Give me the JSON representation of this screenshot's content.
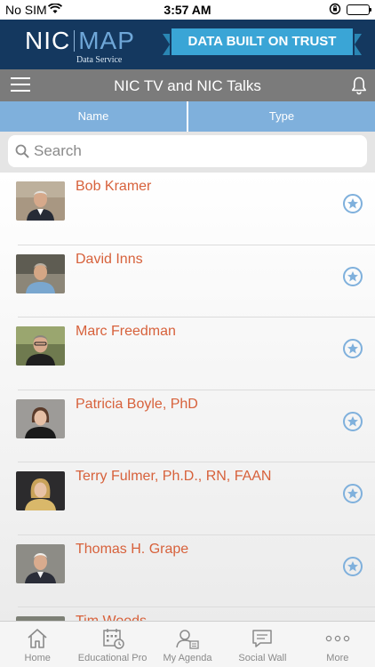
{
  "status_bar": {
    "carrier": "No SIM",
    "time": "3:57 AM"
  },
  "banner": {
    "logo_left": "NIC",
    "logo_right": "MAP",
    "logo_sub": "Data Service",
    "tagline": "DATA BUILT ON TRUST"
  },
  "nav": {
    "title": "NIC TV and NIC Talks"
  },
  "tabs": [
    {
      "label": "Name"
    },
    {
      "label": "Type"
    }
  ],
  "search": {
    "placeholder": "Search",
    "value": ""
  },
  "people": [
    {
      "name": "Bob Kramer"
    },
    {
      "name": "David Inns"
    },
    {
      "name": "Marc Freedman"
    },
    {
      "name": "Patricia Boyle, PhD"
    },
    {
      "name": "Terry Fulmer, Ph.D., RN, FAAN"
    },
    {
      "name": "Thomas H. Grape"
    },
    {
      "name": "Tim Woods"
    }
  ],
  "tabbar": [
    {
      "label": "Home",
      "icon": "home-icon"
    },
    {
      "label": "Educational Pro",
      "icon": "calendar-icon"
    },
    {
      "label": "My Agenda",
      "icon": "agenda-icon"
    },
    {
      "label": "Social Wall",
      "icon": "chat-icon"
    },
    {
      "label": "More",
      "icon": "more-icon"
    }
  ],
  "colors": {
    "banner": "#14385f",
    "navbar": "#7b7b7b",
    "tabs": "#7fb0dc",
    "name_text": "#d7613b",
    "ribbon": "#3aa5d6"
  }
}
